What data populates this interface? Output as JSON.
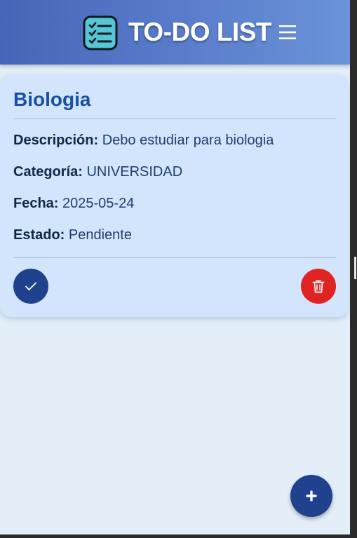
{
  "header": {
    "title": "TO-DO LIST",
    "logo_icon": "checklist-icon",
    "menu_icon": "hamburger-menu-icon"
  },
  "task": {
    "title": "Biologia",
    "description_label": "Descripción:",
    "description": "Debo estudiar para biologia",
    "category_label": "Categoría:",
    "category": "UNIVERSIDAD",
    "date_label": "Fecha:",
    "date": "2025-05-24",
    "status_label": "Estado:",
    "status": "Pendiente",
    "complete_icon": "checkmark-icon",
    "delete_icon": "trash-icon"
  },
  "fab": {
    "icon": "plus-icon"
  },
  "colors": {
    "header_gradient_start": "#4665b8",
    "header_gradient_end": "#6a93d8",
    "page_background": "#e3eef9",
    "card_background": "#d2e5fc",
    "task_title": "#1a4fa6",
    "complete_button": "#20418e",
    "delete_button": "#e02424",
    "fab_button": "#20418e"
  }
}
